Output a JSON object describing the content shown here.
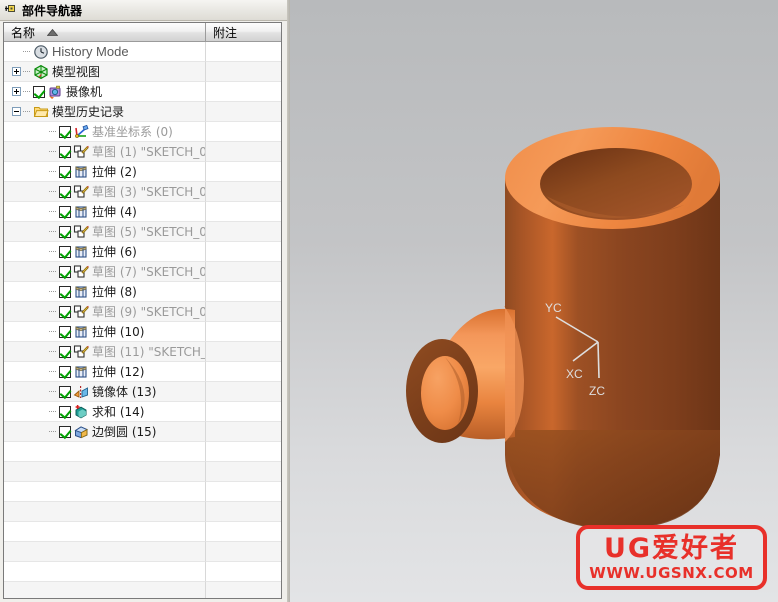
{
  "panel": {
    "pin_icon": "pin-icon",
    "title": "部件导航器",
    "columns": [
      {
        "key": "name",
        "label": "名称",
        "sort_arrow": "▲"
      },
      {
        "key": "note",
        "label": "附注"
      }
    ],
    "rows": [
      {
        "level": 0,
        "expander": "none",
        "check": false,
        "icon": "clock-icon",
        "label": "History Mode",
        "style": "history"
      },
      {
        "level": 0,
        "expander": "plus",
        "check": false,
        "icon": "model-view-icon",
        "label": "模型视图",
        "style": "normal"
      },
      {
        "level": 0,
        "expander": "plus",
        "check": true,
        "icon": "camera-icon",
        "label": "摄像机",
        "style": "normal"
      },
      {
        "level": 0,
        "expander": "minus",
        "check": false,
        "icon": "folder-icon",
        "label": "模型历史记录",
        "style": "normal"
      },
      {
        "level": 1,
        "expander": "none",
        "check": true,
        "icon": "datum-csys-icon",
        "label": "基准坐标系 (0)",
        "style": "dim"
      },
      {
        "level": 1,
        "expander": "none",
        "check": true,
        "icon": "sketch-icon",
        "label": "草图 (1) \"SKETCH_0...",
        "style": "dim"
      },
      {
        "level": 1,
        "expander": "none",
        "check": true,
        "icon": "extrude-icon",
        "label": "拉伸 (2)",
        "style": "normal"
      },
      {
        "level": 1,
        "expander": "none",
        "check": true,
        "icon": "sketch-icon",
        "label": "草图 (3) \"SKETCH_0...",
        "style": "dim"
      },
      {
        "level": 1,
        "expander": "none",
        "check": true,
        "icon": "extrude-icon",
        "label": "拉伸 (4)",
        "style": "normal"
      },
      {
        "level": 1,
        "expander": "none",
        "check": true,
        "icon": "sketch-icon",
        "label": "草图 (5) \"SKETCH_0...",
        "style": "dim"
      },
      {
        "level": 1,
        "expander": "none",
        "check": true,
        "icon": "extrude-icon",
        "label": "拉伸 (6)",
        "style": "normal"
      },
      {
        "level": 1,
        "expander": "none",
        "check": true,
        "icon": "sketch-icon",
        "label": "草图 (7) \"SKETCH_0...",
        "style": "dim"
      },
      {
        "level": 1,
        "expander": "none",
        "check": true,
        "icon": "extrude-icon",
        "label": "拉伸 (8)",
        "style": "normal"
      },
      {
        "level": 1,
        "expander": "none",
        "check": true,
        "icon": "sketch-icon",
        "label": "草图 (9) \"SKETCH_0...",
        "style": "dim"
      },
      {
        "level": 1,
        "expander": "none",
        "check": true,
        "icon": "extrude-icon",
        "label": "拉伸 (10)",
        "style": "normal"
      },
      {
        "level": 1,
        "expander": "none",
        "check": true,
        "icon": "sketch-icon",
        "label": "草图 (11) \"SKETCH_...",
        "style": "dim"
      },
      {
        "level": 1,
        "expander": "none",
        "check": true,
        "icon": "extrude-icon",
        "label": "拉伸 (12)",
        "style": "normal"
      },
      {
        "level": 1,
        "expander": "none",
        "check": true,
        "icon": "mirror-body-icon",
        "label": "镜像体 (13)",
        "style": "normal"
      },
      {
        "level": 1,
        "expander": "none",
        "check": true,
        "icon": "unite-icon",
        "label": "求和 (14)",
        "style": "normal"
      },
      {
        "level": 1,
        "expander": "none",
        "check": true,
        "icon": "edge-blend-icon",
        "label": "边倒圆 (15)",
        "style": "normal"
      }
    ],
    "empty_row_count": 8
  },
  "viewport": {
    "background_top": "#b8babc",
    "background_bottom": "#e3e4e6",
    "model_color_light": "#f2914d",
    "model_color_mid": "#d2672c",
    "model_color_dark": "#7c3c18",
    "triad": {
      "x_label": "XC",
      "y_label": "YC",
      "z_label": "ZC",
      "color": "#dcdcdc"
    }
  },
  "watermark": {
    "main_text": "UG爱好者",
    "sub_text": "WWW.UGSNX.COM",
    "color": "#e8302a"
  }
}
